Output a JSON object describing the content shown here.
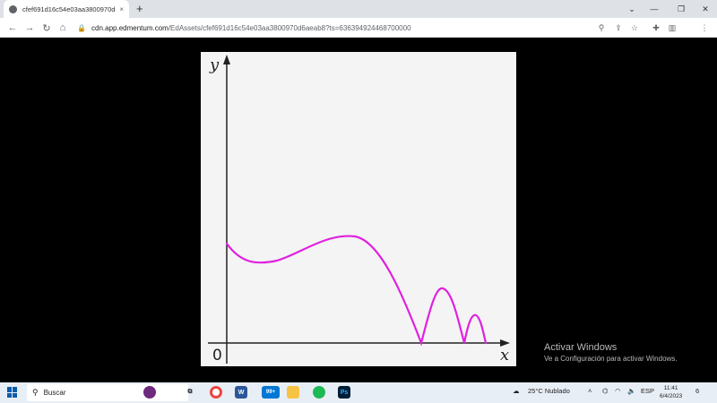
{
  "browser": {
    "tab_title": "cfef691d16c54e03aa3800970d6a",
    "tab_close": "×",
    "new_tab": "+",
    "url_host": "cdn.app.edmentum.com",
    "url_path": "/EdAssets/cfef691d16c54e03aa3800970d6aeab8?ts=636394924468700000"
  },
  "graph": {
    "y_label": "y",
    "x_label": "x",
    "origin_label": "0",
    "curve_color": "#e020e0"
  },
  "watermark": {
    "line1": "Activar Windows",
    "line2": "Ve a Configuración para activar Windows."
  },
  "taskbar": {
    "search_label": "Buscar",
    "badge": "99+",
    "weather": "25°C  Nublado",
    "language": "ESP",
    "time": "11:41",
    "date": "6/4/2023",
    "notification_count": "6"
  }
}
